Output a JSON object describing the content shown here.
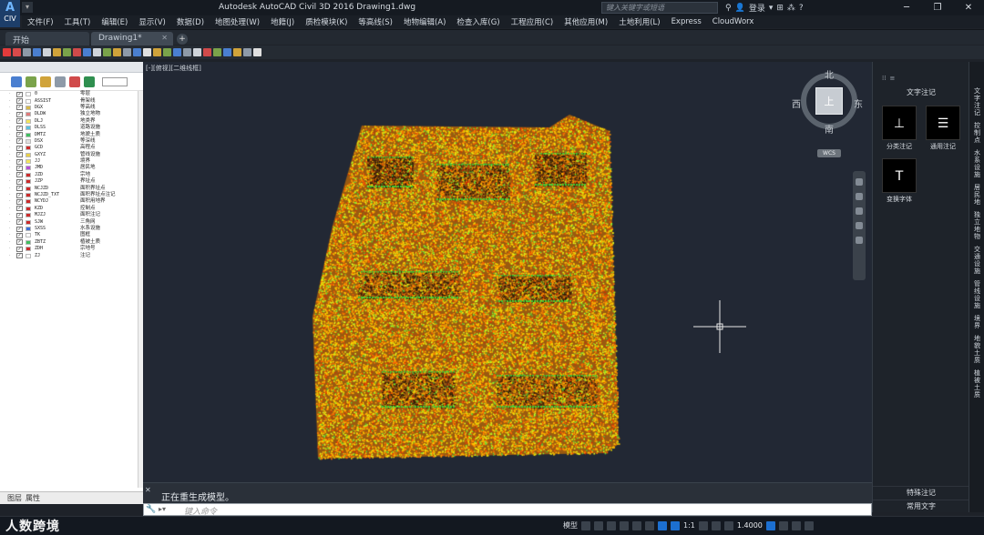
{
  "app": {
    "logo_text": "CIV",
    "title": "Autodesk AutoCAD Civil 3D 2016    Drawing1.dwg"
  },
  "search": {
    "placeholder": "键入关键字或短语"
  },
  "user": {
    "login_label": "登录"
  },
  "menu": [
    "文件(F)",
    "工具(T)",
    "编辑(E)",
    "显示(V)",
    "数据(D)",
    "地图处理(W)",
    "地籍(J)",
    "质检模块(K)",
    "等高线(S)",
    "地物编辑(A)",
    "检查入库(G)",
    "工程应用(C)",
    "其他应用(M)",
    "土地利用(L)",
    "Express",
    "CloudWorx"
  ],
  "tabs": [
    {
      "label": "开始"
    },
    {
      "label": "Drawing1*"
    }
  ],
  "viewport": {
    "label": "[-][俯视][二维线框]",
    "compass": {
      "north": "北",
      "south": "南",
      "east": "东",
      "west": "西",
      "top": "上"
    },
    "wcs_label": "WCS"
  },
  "layers": [
    {
      "code": "0",
      "desc": "零层",
      "color": "#ffffff"
    },
    {
      "code": "ASSIST",
      "desc": "骨架线",
      "color": "#ffffff"
    },
    {
      "code": "DGX",
      "desc": "等高线",
      "color": "#d6b84a"
    },
    {
      "code": "DLDW",
      "desc": "独立地物",
      "color": "#e07b7b"
    },
    {
      "code": "DLJ",
      "desc": "地类界",
      "color": "#f2e45a"
    },
    {
      "code": "DLSS",
      "desc": "道路设施",
      "color": "#5bc0de"
    },
    {
      "code": "DMTZ",
      "desc": "地貌土质",
      "color": "#3fbf5f"
    },
    {
      "code": "DSX",
      "desc": "等深线",
      "color": "#e0e0e0"
    },
    {
      "code": "GCD",
      "desc": "高程点",
      "color": "#cc2a2a"
    },
    {
      "code": "GXYZ",
      "desc": "管线设施",
      "color": "#e8d048"
    },
    {
      "code": "JJ",
      "desc": "境界",
      "color": "#f2e45a"
    },
    {
      "code": "JMD",
      "desc": "居民地",
      "color": "#b44fd8"
    },
    {
      "code": "JZD",
      "desc": "宗地",
      "color": "#cc2a2a"
    },
    {
      "code": "JZP",
      "desc": "界址点",
      "color": "#cc2a2a"
    },
    {
      "code": "NCJZD",
      "desc": "面积界址点",
      "color": "#cc2a2a"
    },
    {
      "code": "NCJZD_TXT",
      "desc": "面积界址点注记",
      "color": "#cc2a2a"
    },
    {
      "code": "NCYDJ",
      "desc": "面积用地界",
      "color": "#cc2a2a"
    },
    {
      "code": "KZD",
      "desc": "控制点",
      "color": "#cc2a2a"
    },
    {
      "code": "MJZJ",
      "desc": "面积注记",
      "color": "#cc2a2a"
    },
    {
      "code": "SJW",
      "desc": "三角网",
      "color": "#cc2a2a"
    },
    {
      "code": "SXSS",
      "desc": "水系设施",
      "color": "#3a6fd8"
    },
    {
      "code": "TK",
      "desc": "图框",
      "color": "#ffffff"
    },
    {
      "code": "ZBTZ",
      "desc": "植被土质",
      "color": "#3fbf5f"
    },
    {
      "code": "ZDH",
      "desc": "宗地号",
      "color": "#cc2a2a"
    },
    {
      "code": "ZJ",
      "desc": "注记",
      "color": "#ffffff"
    }
  ],
  "left_bottom": {
    "tab1": "图层",
    "tab2": "属性"
  },
  "command": {
    "message": "正在重生成模型。",
    "placeholder": "键入命令",
    "icon": "wrench-icon"
  },
  "right_panel": {
    "section_title": "文字注记",
    "tools": [
      {
        "label": "分类注记",
        "icon": "classify-annotation-icon"
      },
      {
        "label": "通用注记",
        "icon": "general-annotation-icon"
      },
      {
        "label": "变换字体",
        "icon": "font-transform-icon"
      }
    ],
    "bottom_buttons": [
      "特殊注记",
      "常用文字"
    ]
  },
  "vertical_tabs": [
    "文字注记",
    "控制点",
    "水系设施",
    "居民地",
    "独立地物",
    "交通设施",
    "管线设施",
    "境界",
    "地貌土质",
    "植被土质"
  ],
  "status": {
    "model_label": "模型",
    "scale": "1:1",
    "zoom_value": "1.4000",
    "watermark": "人数跨境"
  }
}
